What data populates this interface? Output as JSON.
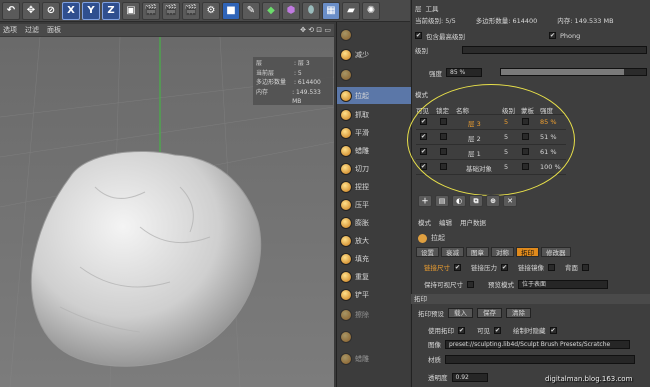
{
  "toolbar": {
    "axis_buttons": [
      "X",
      "Y",
      "Z"
    ],
    "icons": [
      "undo-icon",
      "move-icon",
      "lock-icon",
      "x-axis-icon",
      "y-axis-icon",
      "z-axis-icon",
      "world-icon",
      "clapper-icon",
      "clapper-icon",
      "clapper-icon",
      "render-settings-icon",
      "cube-icon",
      "pen-icon",
      "subdivision-icon",
      "deformer-icon",
      "scene-icon",
      "floor-icon",
      "camera-icon",
      "light-icon"
    ]
  },
  "viewport_menu": [
    "选项",
    "过滤",
    "面板"
  ],
  "hud": {
    "rows": [
      {
        "k": "层",
        "v": ": 层 3"
      },
      {
        "k": "当前层",
        "v": ": 5"
      },
      {
        "k": "多边形数量",
        "v": ": 614400"
      },
      {
        "k": "内存",
        "v": ": 149.533 MB"
      }
    ]
  },
  "brushes": [
    {
      "label": "",
      "dim": true
    },
    {
      "label": "减少",
      "dim": false
    },
    {
      "label": "",
      "dim": true
    },
    {
      "label": "拉起",
      "selected": true
    },
    {
      "label": "抓取"
    },
    {
      "label": "平滑"
    },
    {
      "label": "蜡雕"
    },
    {
      "label": "切刀"
    },
    {
      "label": "捏捏"
    },
    {
      "label": "压平"
    },
    {
      "label": "膨胀"
    },
    {
      "label": "放大"
    },
    {
      "label": "填充"
    },
    {
      "label": "重复"
    },
    {
      "label": "铲平"
    },
    {
      "label": "擦除",
      "dim": true
    },
    {
      "label": "",
      "dim": true
    },
    {
      "label": "蜡雕",
      "dim": true
    }
  ],
  "panel": {
    "header_tabs": [
      "层",
      "工具"
    ],
    "current_level": "当前级别: 5/5",
    "poly_count": "多边形数量: 614400",
    "memory": "内存: 149.533 MB",
    "include_higher": "包含最高级别",
    "phong": "Phong",
    "level_label": "级别",
    "strength_label": "强度",
    "strength_value": "85 %",
    "mode_label": "模式",
    "table_headers": [
      "可见",
      "锁定",
      "名称",
      "级别",
      "蒙板",
      "强度"
    ],
    "layers": [
      {
        "name": "层 3",
        "level": "5",
        "strength": "85 %",
        "active": true
      },
      {
        "name": "层 2",
        "level": "5",
        "strength": "51 %"
      },
      {
        "name": "层 1",
        "level": "5",
        "strength": "61 %"
      },
      {
        "name": "基础对象",
        "level": "5",
        "strength": "100 %"
      }
    ],
    "subtabs": [
      "模式",
      "编辑",
      "用户数据"
    ],
    "brush_name": "拉起",
    "tool_tabs": [
      "设置",
      "衰减",
      "图章",
      "对称",
      "拓印",
      "修改器"
    ],
    "active_tool_tab": "拓印",
    "opt_link_size": "链接尺寸",
    "opt_link_pressure": "链接压力",
    "opt_link_mirror": "链接镜像",
    "opt_back": "背面",
    "opt_keep_visible": "保持可视尺寸",
    "opt_preview_mode": "预览模式",
    "preview_mode_value": "位于表面",
    "section_stamp": "拓印",
    "stamp_preset": "拓印预设",
    "btn_load": "载入",
    "btn_save": "保存",
    "btn_clear": "清除",
    "use_stamp": "使用拓印",
    "visible": "可见",
    "draw_hidden": "绘制时隐藏",
    "image_label": "图像",
    "image_path": "preset://sculpting.lib4d/Sculpt Brush Presets/Scratche",
    "material_label": "材质",
    "opacity_label": "透明度",
    "opacity_value": "0.92"
  },
  "watermark": "digitalman.blog.163.com"
}
